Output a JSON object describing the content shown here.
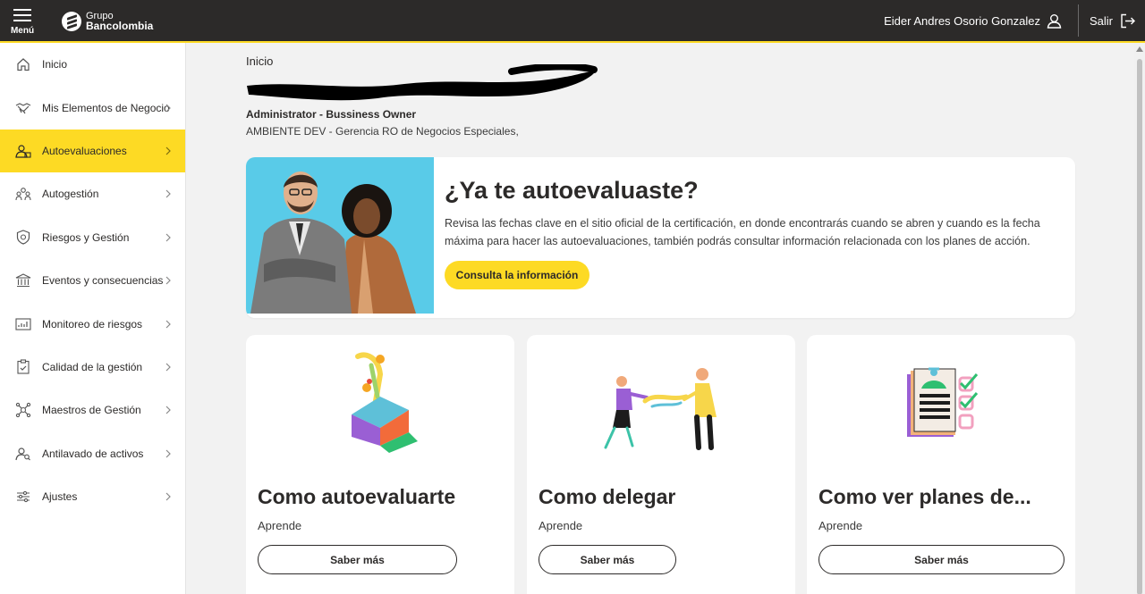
{
  "topbar": {
    "menu_label": "Menú",
    "logo_line1": "Grupo",
    "logo_line2": "Bancolombia",
    "user_name": "Eider Andres Osorio Gonzalez",
    "logout_label": "Salir"
  },
  "sidebar": {
    "items": [
      {
        "label": "Inicio",
        "icon": "home-icon",
        "chevron": false,
        "active": false
      },
      {
        "label": "Mis Elementos de Negocio",
        "icon": "handshake-icon",
        "chevron": true,
        "active": false
      },
      {
        "label": "Autoevaluaciones",
        "icon": "user-check-icon",
        "chevron": true,
        "active": true
      },
      {
        "label": "Autogestión",
        "icon": "people-icon",
        "chevron": true,
        "active": false
      },
      {
        "label": "Riesgos y Gestión",
        "icon": "shield-icon",
        "chevron": true,
        "active": false
      },
      {
        "label": "Eventos y consecuencias",
        "icon": "bank-icon",
        "chevron": true,
        "active": false
      },
      {
        "label": "Monitoreo de riesgos",
        "icon": "monitor-chart-icon",
        "chevron": true,
        "active": false
      },
      {
        "label": "Calidad de la gestión",
        "icon": "clipboard-check-icon",
        "chevron": true,
        "active": false
      },
      {
        "label": "Maestros de Gestión",
        "icon": "network-icon",
        "chevron": true,
        "active": false
      },
      {
        "label": "Antilavado de activos",
        "icon": "user-search-icon",
        "chevron": true,
        "active": false
      },
      {
        "label": "Ajustes",
        "icon": "sliders-icon",
        "chevron": true,
        "active": false
      }
    ]
  },
  "main": {
    "breadcrumb": "Inicio",
    "role": "Administrator - Bussiness Owner",
    "environment": "AMBIENTE DEV - Gerencia RO de Negocios Especiales,",
    "banner": {
      "title": "¿Ya te autoevaluaste?",
      "text": "Revisa las fechas clave en el sitio oficial de la certificación, en donde encontrarás cuando se abren y cuando es la fecha máxima para hacer las autoevaluaciones, también podrás consultar información relacionada con los planes de acción.",
      "button": "Consulta la información"
    },
    "cards": [
      {
        "title": "Como autoevaluarte",
        "subtitle": "Aprende",
        "button": "Saber más"
      },
      {
        "title": "Como delegar",
        "subtitle": "Aprende",
        "button": "Saber más"
      },
      {
        "title": "Como ver planes de...",
        "subtitle": "Aprende",
        "button": "Saber más"
      }
    ]
  },
  "colors": {
    "brand_yellow": "#fdda24",
    "topbar": "#2c2a29",
    "banner_photo_bg": "#59cbe8",
    "page_bg": "#f2f2f2"
  }
}
